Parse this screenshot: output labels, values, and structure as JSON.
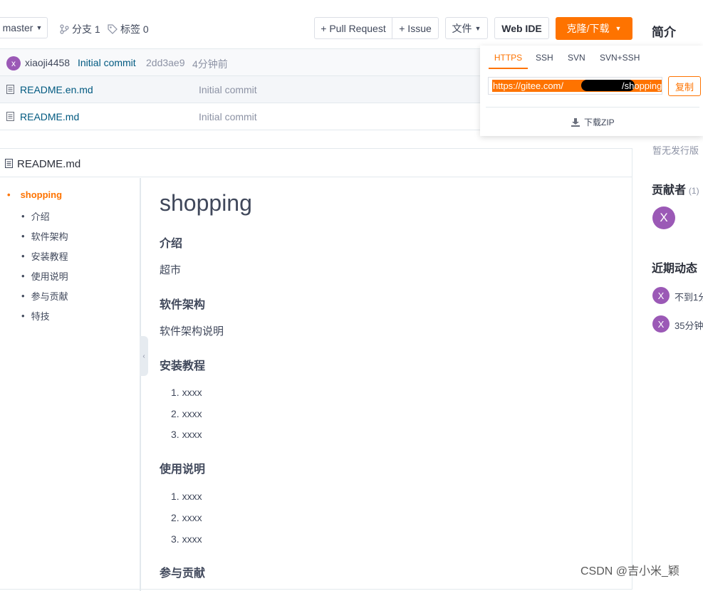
{
  "toolbar": {
    "branch": "master",
    "branches_label": "分支 1",
    "tags_label": "标签 0",
    "pull_request": "+ Pull Request",
    "issue": "+ Issue",
    "file_menu": "文件",
    "web_ide": "Web IDE",
    "clone_download": "克隆/下载"
  },
  "commit": {
    "avatar_letter": "x",
    "author": "xiaoji4458",
    "message": "Initial commit",
    "hash": "2dd3ae9",
    "time": "4分钟前"
  },
  "files": [
    {
      "name": "README.en.md",
      "commit": "Initial commit"
    },
    {
      "name": "README.md",
      "commit": "Initial commit"
    }
  ],
  "clone_popup": {
    "tabs": [
      "HTTPS",
      "SSH",
      "SVN",
      "SVN+SSH"
    ],
    "url_prefix": "https://gitee.com/",
    "url_suffix": "/shopping",
    "copy": "复制",
    "download_zip": "下载ZIP"
  },
  "readme": {
    "header": "README.md",
    "toc": [
      "shopping",
      "介绍",
      "软件架构",
      "安装教程",
      "使用说明",
      "参与贡献",
      "特技"
    ],
    "title": "shopping",
    "intro_heading": "介绍",
    "intro_text": "超市",
    "arch_heading": "软件架构",
    "arch_text": "软件架构说明",
    "install_heading": "安装教程",
    "install_items": [
      "xxxx",
      "xxxx",
      "xxxx"
    ],
    "usage_heading": "使用说明",
    "usage_items": [
      "xxxx",
      "xxxx",
      "xxxx"
    ],
    "contrib_heading": "参与贡献"
  },
  "sidebar": {
    "intro_title": "简介",
    "no_release": "暂无发行版",
    "contributors_title": "贡献者",
    "contributors_count": "(1)",
    "contributor_letter": "X",
    "activity_title": "近期动态",
    "activities": [
      {
        "letter": "X",
        "text": "不到1分"
      },
      {
        "letter": "X",
        "text": "35分钟"
      }
    ]
  },
  "watermark": "CSDN @吉小米_颖",
  "colors": {
    "accent": "#fe7300",
    "link": "#005980",
    "avatar": "#9b59b6"
  }
}
